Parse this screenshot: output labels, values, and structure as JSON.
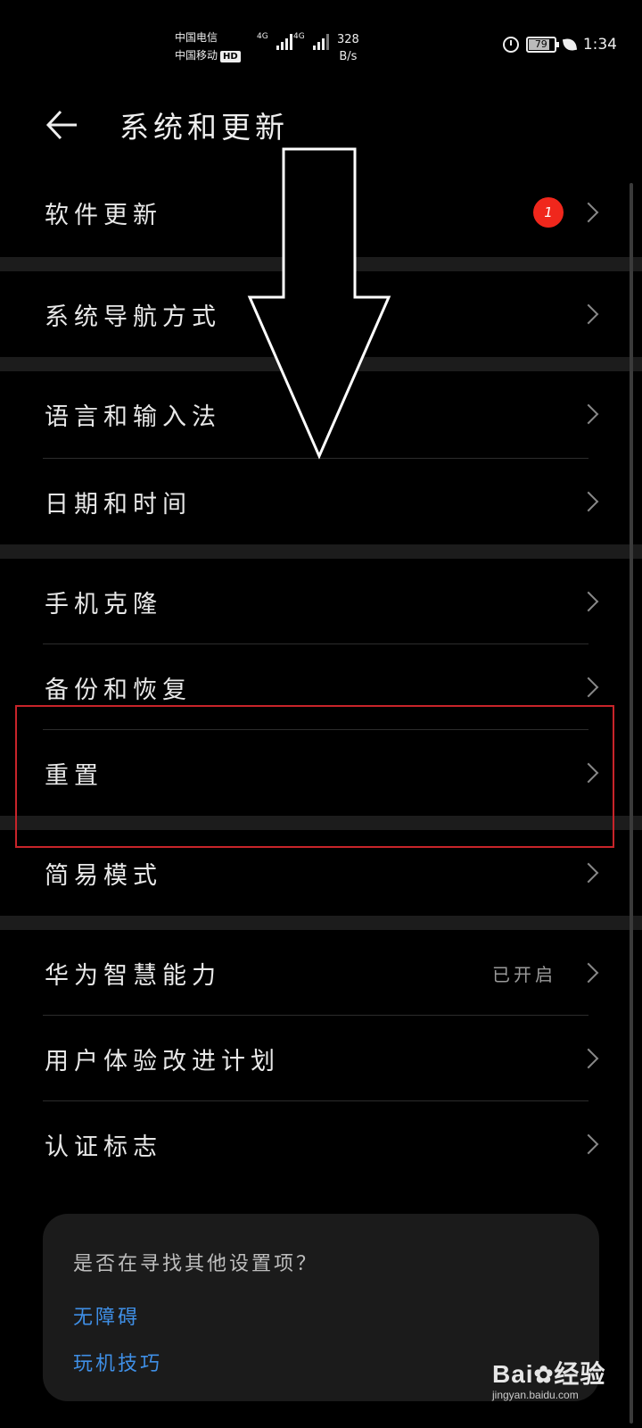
{
  "status_bar": {
    "carrier_1": "中国电信",
    "carrier_2": "中国移动",
    "hd_badge": "HD",
    "net_type_1": "4G",
    "net_type_2": "4G",
    "speed_value": "328",
    "speed_unit": "B/s",
    "battery": "79",
    "time": "1:34"
  },
  "header": {
    "title": "系统和更新"
  },
  "menu": [
    {
      "label": "软件更新",
      "badge": "1"
    },
    {
      "label": "系统导航方式"
    },
    {
      "label": "语言和输入法"
    },
    {
      "label": "日期和时间"
    },
    {
      "label": "手机克隆"
    },
    {
      "label": "备份和恢复"
    },
    {
      "label": "重置"
    },
    {
      "label": "简易模式"
    },
    {
      "label": "华为智慧能力",
      "value": "已开启"
    },
    {
      "label": "用户体验改进计划"
    },
    {
      "label": "认证标志"
    }
  ],
  "suggestions": {
    "question": "是否在寻找其他设置项？",
    "links": [
      "无障碍",
      "玩机技巧"
    ]
  },
  "watermark": {
    "brand": "Bai",
    "brand_cn": "经验",
    "url": "jingyan.baidu.com"
  },
  "colors": {
    "background": "#000000",
    "badge": "#f0271c",
    "link": "#3f8fe6",
    "highlight": "#c8242a"
  }
}
